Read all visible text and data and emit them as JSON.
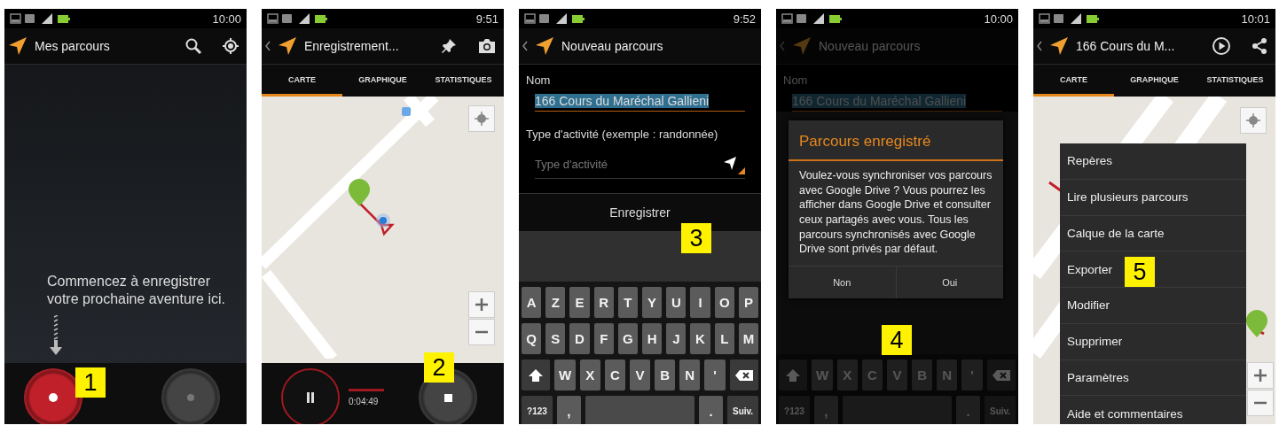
{
  "screens": [
    {
      "kind": "empty",
      "badge": "1",
      "time": "10:00",
      "back": false,
      "title": "Mes parcours",
      "actions": [
        {
          "kind": "search"
        },
        {
          "kind": "locate"
        }
      ],
      "message": "Commencez à enregistrer votre prochaine aventure ici."
    },
    {
      "kind": "recording",
      "badge": "2",
      "time": "9:51",
      "back": true,
      "title": "Enregistrement...",
      "actions": [
        {
          "kind": "pin"
        },
        {
          "kind": "camera"
        }
      ],
      "tabs": [
        {
          "label": "CARTE",
          "selected": true
        },
        {
          "label": "GRAPHIQUE",
          "selected": false
        },
        {
          "label": "STATISTIQUES",
          "selected": false
        }
      ],
      "elapsed": "0:04:49"
    },
    {
      "kind": "form",
      "badge": "3",
      "time": "9:52",
      "back": true,
      "title": "Nouveau parcours",
      "name_label": "Nom",
      "name_value": "166 Cours du Maréchal Gallieni",
      "name_highlighted": true,
      "type_label": "Type d'activité (exemple : randonnée)",
      "type_placeholder": "Type d'activité",
      "save_button": "Enregistrer",
      "keyboard": [
        [
          {
            "kind": "char",
            "label": "A"
          },
          {
            "kind": "char",
            "label": "Z"
          },
          {
            "kind": "char",
            "label": "E"
          },
          {
            "kind": "char",
            "label": "R"
          },
          {
            "kind": "char",
            "label": "T"
          },
          {
            "kind": "char",
            "label": "Y"
          },
          {
            "kind": "char",
            "label": "U"
          },
          {
            "kind": "char",
            "label": "I"
          },
          {
            "kind": "char",
            "label": "O"
          },
          {
            "kind": "char",
            "label": "P"
          }
        ],
        [
          {
            "kind": "char",
            "label": "Q"
          },
          {
            "kind": "char",
            "label": "S"
          },
          {
            "kind": "char",
            "label": "D"
          },
          {
            "kind": "char",
            "label": "F"
          },
          {
            "kind": "char",
            "label": "G"
          },
          {
            "kind": "char",
            "label": "H"
          },
          {
            "kind": "char",
            "label": "J"
          },
          {
            "kind": "char",
            "label": "K"
          },
          {
            "kind": "char",
            "label": "L"
          },
          {
            "kind": "char",
            "label": "M"
          }
        ],
        [
          {
            "kind": "shift"
          },
          {
            "kind": "char",
            "label": "W"
          },
          {
            "kind": "char",
            "label": "X"
          },
          {
            "kind": "char",
            "label": "C"
          },
          {
            "kind": "char",
            "label": "V"
          },
          {
            "kind": "char",
            "label": "B"
          },
          {
            "kind": "char",
            "label": "N"
          },
          {
            "kind": "char",
            "label": "'"
          },
          {
            "kind": "backspace"
          }
        ],
        [
          {
            "kind": "function",
            "label": "?123"
          },
          {
            "kind": "char",
            "label": ","
          },
          {
            "kind": "space"
          },
          {
            "kind": "char",
            "label": "."
          },
          {
            "kind": "function",
            "label": "Suiv."
          }
        ]
      ]
    },
    {
      "kind": "dialog",
      "badge": "4",
      "time": "10:00",
      "back": true,
      "title": "Nouveau parcours",
      "name_label": "Nom",
      "name_value": "166 Cours du Maréchal Gallieni",
      "name_highlighted": true,
      "dialog": {
        "title": "Parcours enregistré",
        "message": "Voulez-vous synchroniser vos parcours avec Google Drive ? Vous pourrez les afficher dans Google Drive et consulter ceux partagés avec vous. Tous les parcours synchronisés avec Google Drive sont privés par défaut.",
        "buttons": [
          "Non",
          "Oui"
        ]
      },
      "keyboard": [
        [
          {
            "kind": "shift"
          },
          {
            "kind": "char",
            "label": "W"
          },
          {
            "kind": "char",
            "label": "X"
          },
          {
            "kind": "char",
            "label": "C"
          },
          {
            "kind": "char",
            "label": "V"
          },
          {
            "kind": "char",
            "label": "B"
          },
          {
            "kind": "char",
            "label": "N"
          },
          {
            "kind": "char",
            "label": "'"
          },
          {
            "kind": "backspace"
          }
        ],
        [
          {
            "kind": "function",
            "label": "?123"
          },
          {
            "kind": "char",
            "label": ","
          },
          {
            "kind": "space"
          },
          {
            "kind": "char",
            "label": "."
          },
          {
            "kind": "function",
            "label": "Suiv."
          }
        ]
      ]
    },
    {
      "kind": "menu",
      "badge": "5",
      "time": "10:01",
      "back": true,
      "title": "166 Cours du M...",
      "actions": [
        {
          "kind": "play"
        },
        {
          "kind": "share"
        }
      ],
      "tabs": [
        {
          "label": "CARTE",
          "selected": true
        },
        {
          "label": "GRAPHIQUE",
          "selected": false
        },
        {
          "label": "STATISTIQUES",
          "selected": false
        }
      ],
      "menu": [
        "Repères",
        "Lire plusieurs parcours",
        "Calque de la carte",
        "Exporter",
        "Modifier",
        "Supprimer",
        "Paramètres",
        "Aide et commentaires"
      ]
    }
  ]
}
